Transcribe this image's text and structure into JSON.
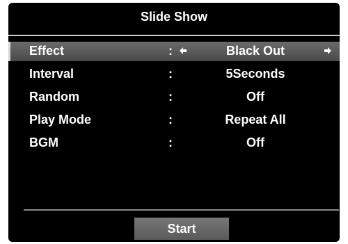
{
  "osd": {
    "title": "Slide Show",
    "rows": [
      {
        "label": "Effect",
        "colon": ":",
        "value": "Black Out",
        "selected": true
      },
      {
        "label": "Interval",
        "colon": ":",
        "value": "5Seconds"
      },
      {
        "label": "Random",
        "colon": ":",
        "value": "Off"
      },
      {
        "label": "Play Mode",
        "colon": ":",
        "value": "Repeat All"
      },
      {
        "label": "BGM",
        "colon": ":",
        "value": "Off"
      }
    ],
    "start_label": "Start"
  },
  "colors": {
    "background": "#000000",
    "text": "#ffffff",
    "highlight": "#5a5a5a",
    "start_button": "#686868"
  },
  "icons": {
    "left": "arrow-left-icon",
    "right": "arrow-right-icon"
  }
}
